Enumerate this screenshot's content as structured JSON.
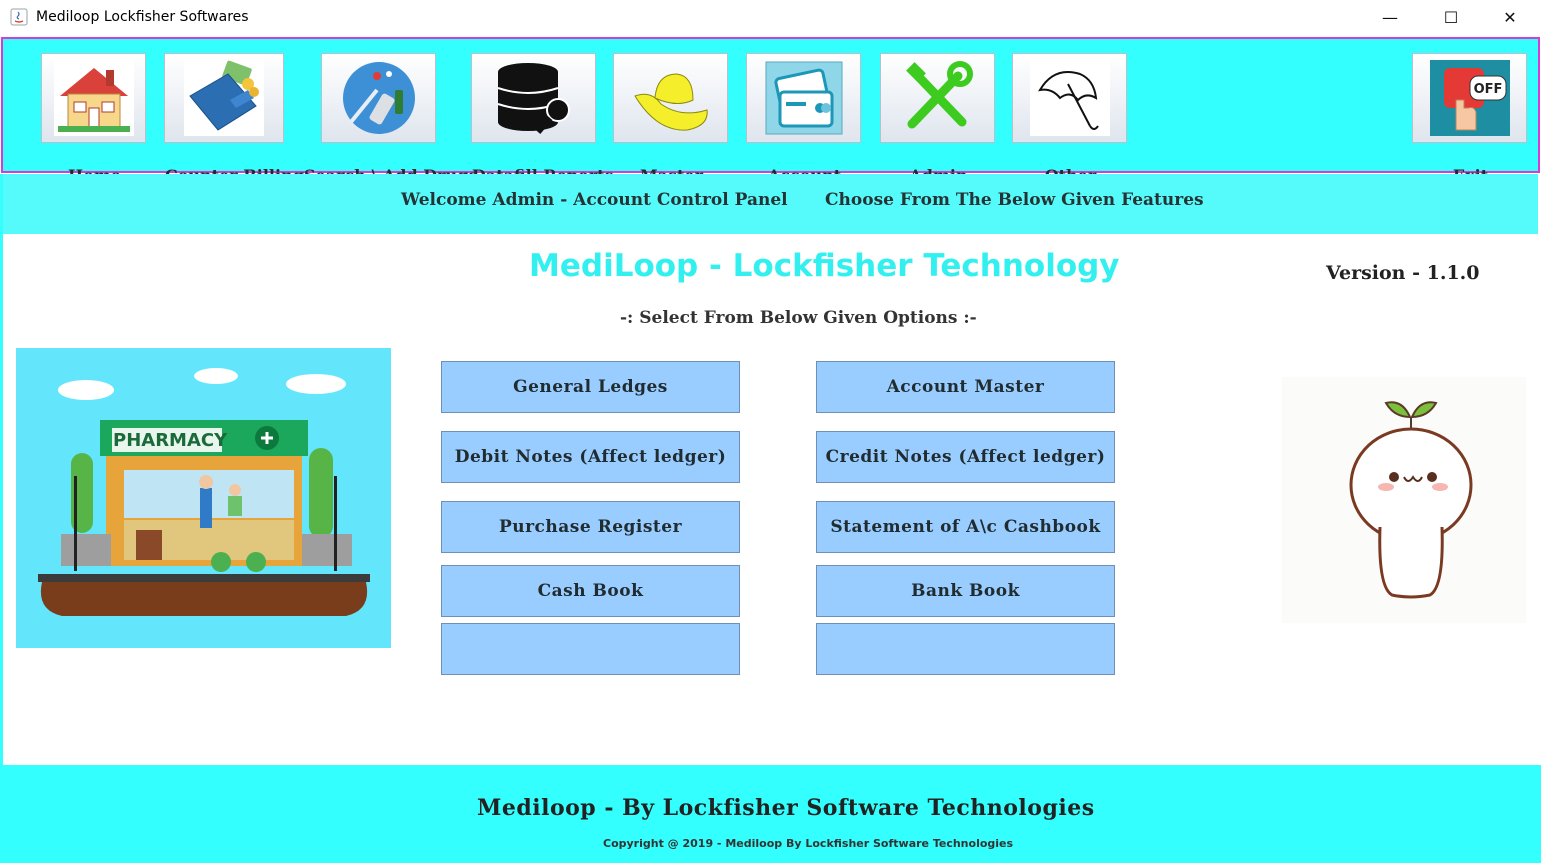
{
  "window": {
    "title": "Mediloop Lockfisher Softwares",
    "controls": {
      "minimize": "—",
      "maximize": "☐",
      "close": "✕"
    }
  },
  "toolbar": {
    "items": [
      {
        "label": "Home",
        "icon": "house-icon"
      },
      {
        "label": "Counter Billing",
        "icon": "wallet-icon"
      },
      {
        "label": "Search \\ Add Drugs",
        "icon": "medicine-icon"
      },
      {
        "label": "Datafill Reports",
        "icon": "database-key-icon"
      },
      {
        "label": "Master",
        "icon": "hat-icon"
      },
      {
        "label": "Account",
        "icon": "credit-card-icon"
      },
      {
        "label": "Admin",
        "icon": "tools-icon"
      },
      {
        "label": "Other",
        "icon": "umbrella-icon"
      },
      {
        "label": "Exit",
        "icon": "power-off-icon"
      }
    ]
  },
  "welcome": {
    "left": "Welcome Admin - Account Control Panel",
    "right": "Choose From The Below Given Features"
  },
  "main": {
    "brand": "MediLoop - Lockfisher Technology",
    "version": "Version - 1.1.0",
    "select_note": "-: Select From Below Given Options :-",
    "pharmacy_sign": "PHARMACY",
    "options_left": [
      "General Ledges",
      "Debit Notes (Affect ledger)",
      "Purchase Register",
      "Cash Book",
      ""
    ],
    "options_right": [
      "Account Master",
      "Credit Notes (Affect ledger)",
      "Statement of A\\c Cashbook",
      "Bank Book",
      ""
    ]
  },
  "footer": {
    "title": "Mediloop - By Lockfisher Software Technologies",
    "copyright": "Copyright @ 2019 - Mediloop By Lockfisher Software Technologies"
  },
  "colors": {
    "accent_cyan": "#33ffff",
    "toolbar_border": "#d63bd6",
    "option_button": "#99ccff",
    "brand_text": "#33f0f0"
  }
}
